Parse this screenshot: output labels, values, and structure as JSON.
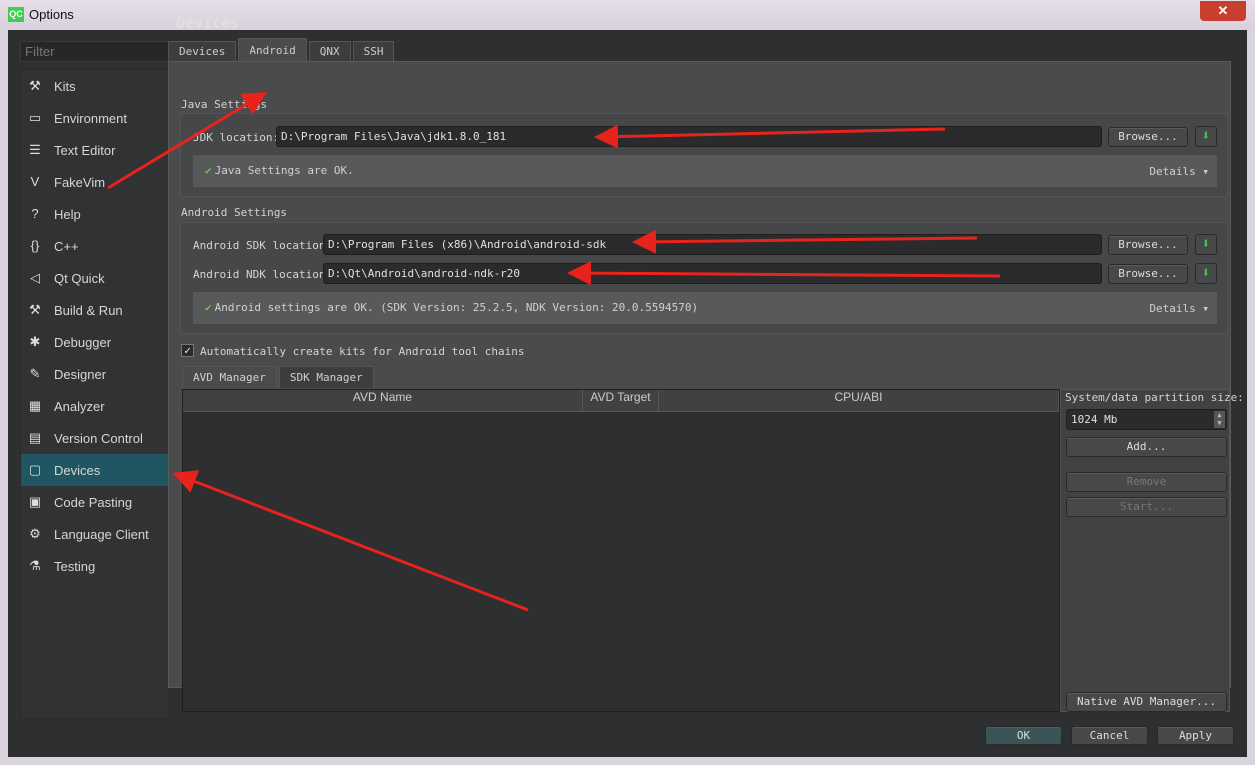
{
  "window": {
    "title": "Options",
    "logo": "QC",
    "close_label": "✕"
  },
  "filter": {
    "placeholder": "Filter"
  },
  "sidebar": {
    "items": [
      {
        "label": "Kits",
        "icon": "kits-icon",
        "glyph": "⚒"
      },
      {
        "label": "Environment",
        "icon": "monitor-icon",
        "glyph": "▭"
      },
      {
        "label": "Text Editor",
        "icon": "text-editor-icon",
        "glyph": "☰"
      },
      {
        "label": "FakeVim",
        "icon": "fakevim-icon",
        "glyph": "V"
      },
      {
        "label": "Help",
        "icon": "help-icon",
        "glyph": "?"
      },
      {
        "label": "C++",
        "icon": "cpp-icon",
        "glyph": "{}"
      },
      {
        "label": "Qt Quick",
        "icon": "qt-quick-icon",
        "glyph": "◁"
      },
      {
        "label": "Build & Run",
        "icon": "hammer-icon",
        "glyph": "⚒"
      },
      {
        "label": "Debugger",
        "icon": "bug-icon",
        "glyph": "✱"
      },
      {
        "label": "Designer",
        "icon": "pencil-icon",
        "glyph": "✎"
      },
      {
        "label": "Analyzer",
        "icon": "analyzer-icon",
        "glyph": "▦"
      },
      {
        "label": "Version Control",
        "icon": "version-control-icon",
        "glyph": "▤"
      },
      {
        "label": "Devices",
        "icon": "devices-icon",
        "glyph": "▢",
        "selected": true
      },
      {
        "label": "Code Pasting",
        "icon": "clipboard-icon",
        "glyph": "▣"
      },
      {
        "label": "Language Client",
        "icon": "language-client-icon",
        "glyph": "⚙"
      },
      {
        "label": "Testing",
        "icon": "flask-icon",
        "glyph": "⚗"
      }
    ]
  },
  "page": {
    "title": "Devices"
  },
  "tabs": [
    {
      "label": "Devices"
    },
    {
      "label": "Android",
      "selected": true
    },
    {
      "label": "QNX"
    },
    {
      "label": "SSH"
    }
  ],
  "java": {
    "section": "Java Settings",
    "sdk_label": "JDK location:",
    "sdk_value": "D:\\Program Files\\Java\\jdk1.8.0_181",
    "browse": "Browse...",
    "status": "Java Settings are OK.",
    "details": "Details ▾"
  },
  "android": {
    "section": "Android Settings",
    "sdk_label": "Android SDK location:",
    "sdk_value": "D:\\Program Files (x86)\\Android\\android-sdk",
    "ndk_label": "Android NDK location:",
    "ndk_value": "D:\\Qt\\Android\\android-ndk-r20",
    "browse": "Browse...",
    "status": "Android settings are OK.  (SDK Version: 25.2.5, NDK Version: 20.0.5594570)",
    "details": "Details ▾"
  },
  "auto_kits": {
    "label": "Automatically create kits for Android tool chains",
    "checked": true
  },
  "subtabs": [
    {
      "label": "AVD Manager",
      "selected": true
    },
    {
      "label": "SDK Manager"
    }
  ],
  "avd_table": {
    "columns": [
      "AVD Name",
      "AVD Target",
      "CPU/ABI"
    ],
    "rows": []
  },
  "avd_side": {
    "partition_label": "System/data partition size:",
    "partition_value": "1024 Mb",
    "add": "Add...",
    "remove": "Remove",
    "start": "Start...",
    "native": "Native AVD Manager..."
  },
  "footer": {
    "ok": "OK",
    "cancel": "Cancel",
    "apply": "Apply"
  },
  "colors": {
    "accent_selected": "#1f5662",
    "ok_check": "#6bc24a",
    "download": "#3ad33a",
    "annotation_arrow": "#e8231b"
  }
}
